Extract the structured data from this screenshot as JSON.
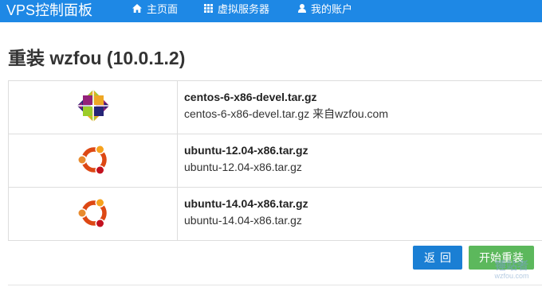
{
  "navbar": {
    "brand": "VPS控制面板",
    "items": [
      {
        "label": "主页面",
        "icon": "home-icon"
      },
      {
        "label": "虚拟服务器",
        "icon": "grid-icon"
      },
      {
        "label": "我的账户",
        "icon": "user-icon"
      }
    ]
  },
  "page": {
    "title": "重装 wzfou (10.0.1.2)"
  },
  "images": [
    {
      "name": "centos-6-x86-devel.tar.gz",
      "description": "centos-6-x86-devel.tar.gz 来自wzfou.com",
      "logo": "centos-logo"
    },
    {
      "name": "ubuntu-12.04-x86.tar.gz",
      "description": "ubuntu-12.04-x86.tar.gz",
      "logo": "ubuntu-logo"
    },
    {
      "name": "ubuntu-14.04-x86.tar.gz",
      "description": "ubuntu-14.04-x86.tar.gz",
      "logo": "ubuntu-logo"
    }
  ],
  "actions": {
    "back_label": "返回",
    "reinstall_label": "开始重装"
  },
  "watermark": {
    "brand": "锤站者",
    "domain": "wzfou.com"
  },
  "colors": {
    "navbar": "#1e88e5",
    "back_button": "#1a7fd4",
    "reinstall_button": "#5cb85c",
    "ubuntu_orange": "#dd4814"
  }
}
